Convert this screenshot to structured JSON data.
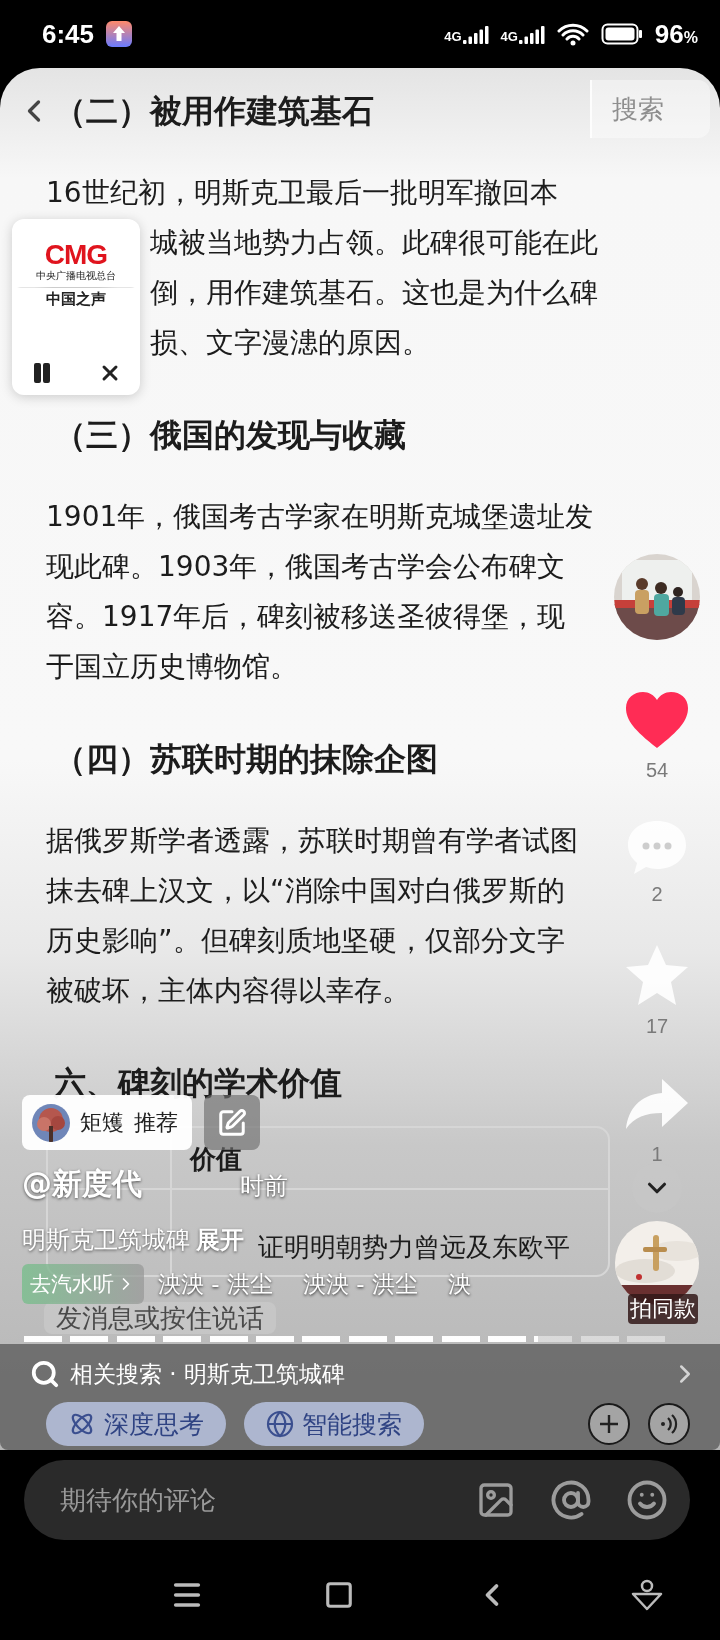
{
  "status_bar": {
    "time": "6:45",
    "network": [
      "4G",
      "4G"
    ],
    "battery": "96",
    "battery_unit": "%"
  },
  "top_bar": {
    "search_button": "搜索"
  },
  "article": [
    {
      "kind": "heading",
      "text": "（二）被用作建筑基石"
    },
    {
      "kind": "paragraph",
      "covered": false,
      "lines": [
        "16世纪初，明斯克卫最后一批明军撤回本"
      ]
    },
    {
      "kind": "paragraph",
      "covered": true,
      "lines": [
        "城被当地势力占领。此碑很可能在此",
        "倒，用作建筑基石。这也是为什么碑",
        "损、文字漫漶的原因。"
      ]
    },
    {
      "kind": "heading",
      "text": "（三）俄国的发现与收藏"
    },
    {
      "kind": "paragraph",
      "covered": false,
      "lines": [
        "1901年，俄国考古学家在明斯克城堡遗址发",
        "现此碑。1903年，俄国考古学会公布碑文",
        "容。1917年后，碑刻被移送圣彼得堡，现",
        "于国立历史博物馆。"
      ]
    },
    {
      "kind": "heading",
      "text": "（四）苏联时期的抹除企图"
    },
    {
      "kind": "paragraph",
      "covered": false,
      "lines": [
        "据俄罗斯学者透露，苏联时期曾有学者试图",
        "抹去碑上汉文，以“消除中国对白俄罗斯的",
        "历史影响”。但碑刻质地坚硬，仅部分文字",
        "被破坏，主体内容得以幸存。"
      ]
    },
    {
      "kind": "heading",
      "text": "六、碑刻的学术价值"
    },
    {
      "kind": "table",
      "value_header": "价值",
      "rows": [
        {
          "value": "证明明朝势力曾远及东欧平"
        }
      ]
    }
  ],
  "mini_player": {
    "brand": "CMG",
    "brand_subtitle": "中央广播电视总台",
    "station": "中国之声"
  },
  "side_actions": [
    {
      "kind": "like",
      "count": "54",
      "selected": true
    },
    {
      "kind": "comment",
      "count": "2"
    },
    {
      "kind": "favorite",
      "count": "17",
      "selected": false
    },
    {
      "kind": "share",
      "count": "1"
    }
  ],
  "remix_label": "拍同款",
  "recommend": {
    "name": "矩矱",
    "label": "推荐"
  },
  "author": "@新度代",
  "time": "时前",
  "description": {
    "text": "明斯克卫筑城碑",
    "expand": "展开"
  },
  "music": {
    "app_link": "去汽水听",
    "titles": [
      "泱泱 - 洪尘",
      "泱泱 - 洪尘",
      "泱"
    ]
  },
  "progress": {
    "level": 0.79
  },
  "chat_bar": {
    "placeholder": "发消息或按住说话",
    "chips": [
      "深度思考",
      "智能搜索"
    ]
  },
  "related_search": {
    "label": "相关搜索 · 明斯克卫筑城碑"
  },
  "comment_field": {
    "placeholder": "期待你的评论"
  }
}
